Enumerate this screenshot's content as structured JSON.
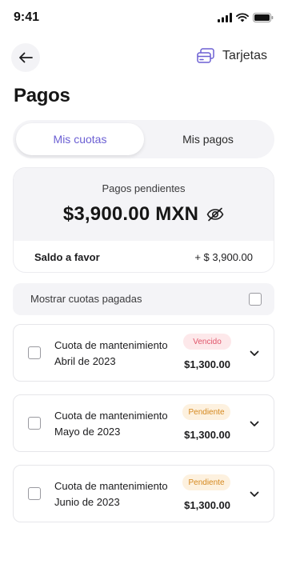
{
  "status_bar": {
    "time": "9:41"
  },
  "header": {
    "cards_label": "Tarjetas"
  },
  "page": {
    "title": "Pagos"
  },
  "tabs": [
    {
      "label": "Mis cuotas",
      "active": true
    },
    {
      "label": "Mis pagos",
      "active": false
    }
  ],
  "balance": {
    "pending_label": "Pagos pendientes",
    "pending_amount": "$3,900.00 MXN",
    "favor_label": "Saldo a favor",
    "favor_amount": "+ $ 3,900.00"
  },
  "filters": {
    "show_paid_label": "Mostrar cuotas pagadas",
    "show_paid_checked": false
  },
  "fees": [
    {
      "title": "Cuota de mantenimiento",
      "period": "Abril de 2023",
      "status": "Vencido",
      "amount": "$1,300.00"
    },
    {
      "title": "Cuota de mantenimiento",
      "period": "Mayo de 2023",
      "status": "Pendiente",
      "amount": "$1,300.00"
    },
    {
      "title": "Cuota de mantenimiento",
      "period": "Junio de 2023",
      "status": "Pendiente",
      "amount": "$1,300.00"
    }
  ],
  "colors": {
    "accent": "#6b5fd3",
    "vencido_text": "#e0556a",
    "vencido_bg": "#fde8ea",
    "pendiente_text": "#d5881e",
    "pendiente_bg": "#fdf1df"
  },
  "icons": {
    "back": "arrow-left-icon",
    "cards": "credit-card-icon",
    "visibility": "eye-off-icon",
    "expand": "chevron-down-icon"
  }
}
